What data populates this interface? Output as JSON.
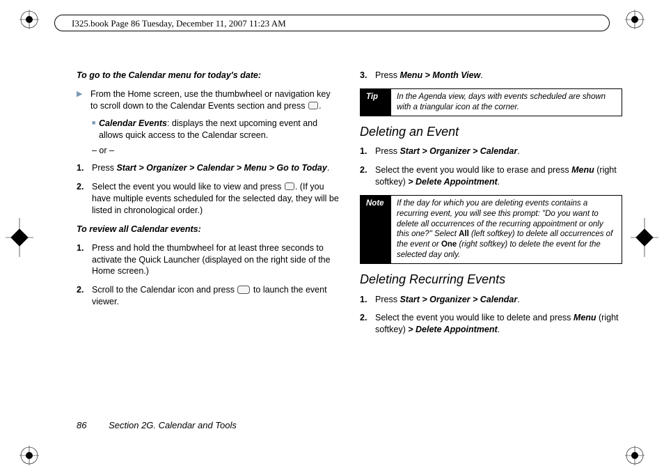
{
  "header": "I325.book  Page 86  Tuesday, December 11, 2007  11:23 AM",
  "left": {
    "h1": "To go to the Calendar menu for today's date:",
    "arrow_text_a": "From the Home screen, use the thumbwheel or navigation key to scroll down to the Calendar Events section and press ",
    "arrow_text_b": ".",
    "sub_label": "Calendar Events",
    "sub_text": ": displays the next upcoming event and allows quick access to the Calendar screen.",
    "or": "– or –",
    "item1_a": "Press ",
    "item1_b": "Start > Organizer > Calendar > Menu > Go to Today",
    "item1_c": ".",
    "item2_a": "Select the event you would like to view and press ",
    "item2_b": ". (If you have multiple events scheduled for the selected day, they will be listed in chronological order.)",
    "h2": "To review all Calendar events:",
    "r1": "Press and hold the thumbwheel for at least three seconds to activate the Quick Launcher (displayed on the right side of the Home screen.)",
    "r2_a": "Scroll to the Calendar icon and press ",
    "r2_b": " to launch the event viewer."
  },
  "right": {
    "top_item_a": "Press ",
    "top_item_b": "Menu > Month View",
    "top_item_c": ".",
    "tip_label": "Tip",
    "tip_text": "In the Agenda view, days with events scheduled are shown with a triangular icon at the corner.",
    "h1": "Deleting an Event",
    "d1_a": "Press ",
    "d1_b": "Start > Organizer > Calendar",
    "d1_c": ".",
    "d2_a": "Select the event you would like to erase and press ",
    "d2_b": "Menu",
    "d2_c": " (right softkey) ",
    "d2_d": "> Delete Appointment",
    "d2_e": ".",
    "note_label": "Note",
    "note_a": "If the day for which you are deleting events contains a recurring event, you will see this prompt: \"Do you want to delete all occurrences of the recurring appointment or only this one?\" Select ",
    "note_b": "All",
    "note_c": " (left softkey) to delete all occurrences of the event or ",
    "note_d": "One",
    "note_e": " (right softkey) to delete the event for the selected day only.",
    "h2": "Deleting Recurring Events",
    "e1_a": "Press ",
    "e1_b": "Start > Organizer > Calendar",
    "e1_c": ".",
    "e2_a": "Select the event you would like to delete and press ",
    "e2_b": "Menu",
    "e2_c": " (right softkey) ",
    "e2_d": "> Delete Appointment",
    "e2_e": "."
  },
  "footer": {
    "page": "86",
    "section": "Section 2G. Calendar and Tools"
  }
}
